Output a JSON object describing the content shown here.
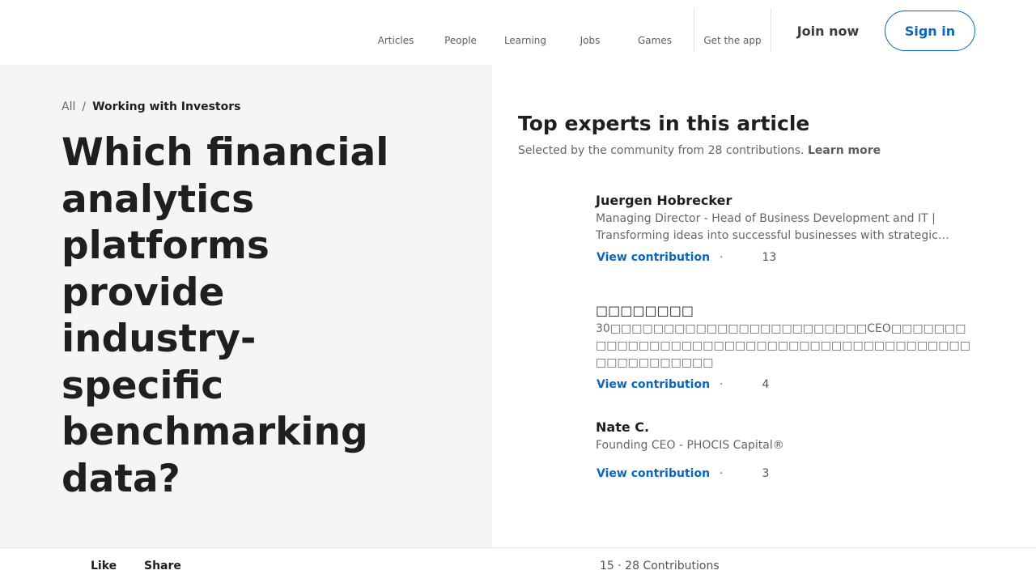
{
  "nav": {
    "items": [
      {
        "label": "Articles",
        "icon": "articles-icon"
      },
      {
        "label": "People",
        "icon": "people-icon"
      },
      {
        "label": "Learning",
        "icon": "learning-icon"
      },
      {
        "label": "Jobs",
        "icon": "jobs-icon"
      },
      {
        "label": "Games",
        "icon": "games-icon"
      },
      {
        "label": "Get the app",
        "icon": "app-icon"
      }
    ],
    "join_label": "Join now",
    "signin_label": "Sign in"
  },
  "breadcrumb": {
    "all": "All",
    "separator": "/",
    "current": "Working with Investors"
  },
  "article": {
    "title": "Which financial analytics platforms provide industry-specific benchmarking data?"
  },
  "experts": {
    "title": "Top experts in this article",
    "subtitle": "Selected by the community from 28 contributions.",
    "learn_more": "Learn more",
    "list": [
      {
        "name": "Juergen Hobrecker",
        "headline": "Managing Director - Head of Business Development and IT | Transforming ideas into successful businesses with strategic…",
        "view_label": "View contribution",
        "dot": "·",
        "count": "13"
      },
      {
        "name": "□□□□□□□□",
        "headline": "30□□□□□□□□□□□□□□□□□□□□□□□□CEO□□□□□□□□□□□□□□□□□□□□□□□□□□□□□□□□□□□□□□□□□□□□□□□□□□□□□",
        "view_label": "View contribution",
        "dot": "·",
        "count": "4"
      },
      {
        "name": "Nate C.",
        "headline": "Founding CEO - PHOCIS Capital®",
        "view_label": "View contribution",
        "dot": "·",
        "count": "3"
      }
    ]
  },
  "bottom": {
    "like_label": "Like",
    "share_label": "Share",
    "stats": "15 · 28 Contributions"
  },
  "colors": {
    "accent": "#0a66c2",
    "left_bg": "#f4f5f7"
  }
}
